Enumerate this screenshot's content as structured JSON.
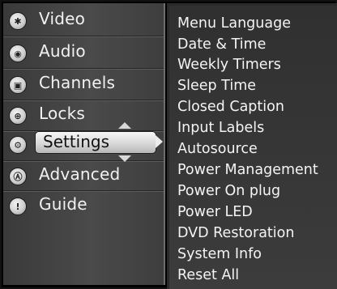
{
  "main_menu": {
    "items": [
      {
        "label": "Video",
        "icon": "video-icon",
        "glyph": "✱"
      },
      {
        "label": "Audio",
        "icon": "audio-icon",
        "glyph": "◉"
      },
      {
        "label": "Channels",
        "icon": "channels-icon",
        "glyph": "▣"
      },
      {
        "label": "Locks",
        "icon": "lock-icon",
        "glyph": "⊕"
      },
      {
        "label": "Settings",
        "icon": "settings-icon",
        "glyph": "⚙"
      },
      {
        "label": "Advanced",
        "icon": "advanced-icon",
        "glyph": "Ⓐ"
      },
      {
        "label": "Guide",
        "icon": "guide-icon",
        "glyph": "!"
      }
    ],
    "selected_label": "Settings"
  },
  "submenu": {
    "items": [
      "Menu Language",
      "Date & Time",
      "Weekly Timers",
      "Sleep Time",
      "Closed Caption",
      "Input Labels",
      "Autosource",
      "Power Management",
      "Power On plug",
      "Power LED",
      "DVD Restoration",
      "System Info",
      "Reset All"
    ]
  },
  "colors": {
    "panel": "#3a3a3a",
    "text": "#f2f2f2",
    "highlight": "#d8d8d8"
  }
}
